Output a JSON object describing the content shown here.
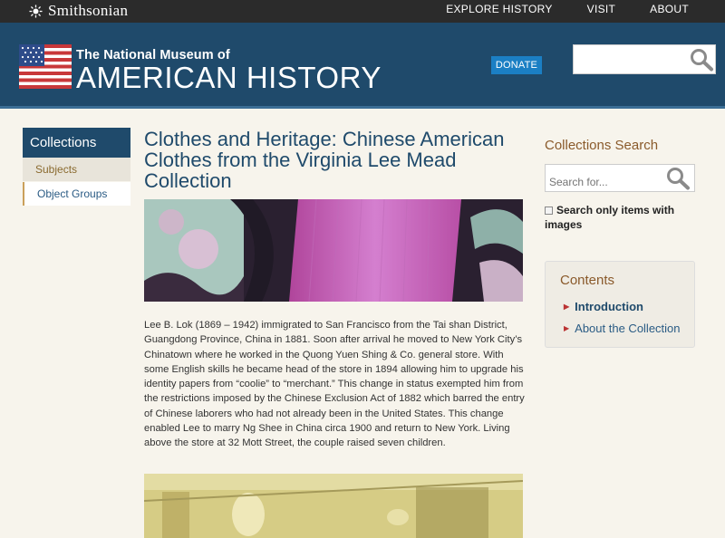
{
  "topbar": {
    "brand": "Smithsonian",
    "nav": [
      "EXPLORE HISTORY",
      "VISIT",
      "ABOUT"
    ]
  },
  "header": {
    "subtitle": "The National Museum of",
    "title": "AMERICAN HISTORY",
    "donate_label": "DONATE",
    "search_placeholder": ""
  },
  "sidebar": {
    "heading": "Collections",
    "items": [
      "Subjects",
      "Object Groups"
    ]
  },
  "main": {
    "title": "Clothes and Heritage: Chinese American Clothes from the Virginia Lee Mead Collection",
    "body": "Lee B. Lok (1869 – 1942) immigrated to San Francisco from the Tai shan District, Guangdong Province, China in 1881.   Soon after arrival he moved to New York City’s Chinatown where he worked in the Quong Yuen Shing & Co. general store.  With some English skills he became head of the store in 1894 allowing him to upgrade his identity papers from “coolie” to “merchant.”   This change in status exempted him from the restrictions imposed by the Chinese Exclusion Act of 1882 which barred the entry of Chinese laborers who had not already been in the United States.  This change enabled Lee to marry Ng Shee in China circa 1900 and return to New York.  Living above the store at 32 Mott Street, the couple raised seven children."
  },
  "collections_search": {
    "title": "Collections Search",
    "placeholder": "Search for...",
    "checkbox_label": "Search only items with images"
  },
  "contents": {
    "title": "Contents",
    "items": [
      "Introduction",
      "About the Collection"
    ]
  },
  "colors": {
    "header_blue": "#1f4a6b",
    "donate_blue": "#1b7fc4",
    "accent_brown": "#8a5a2b",
    "topbar": "#2b2b2b"
  }
}
